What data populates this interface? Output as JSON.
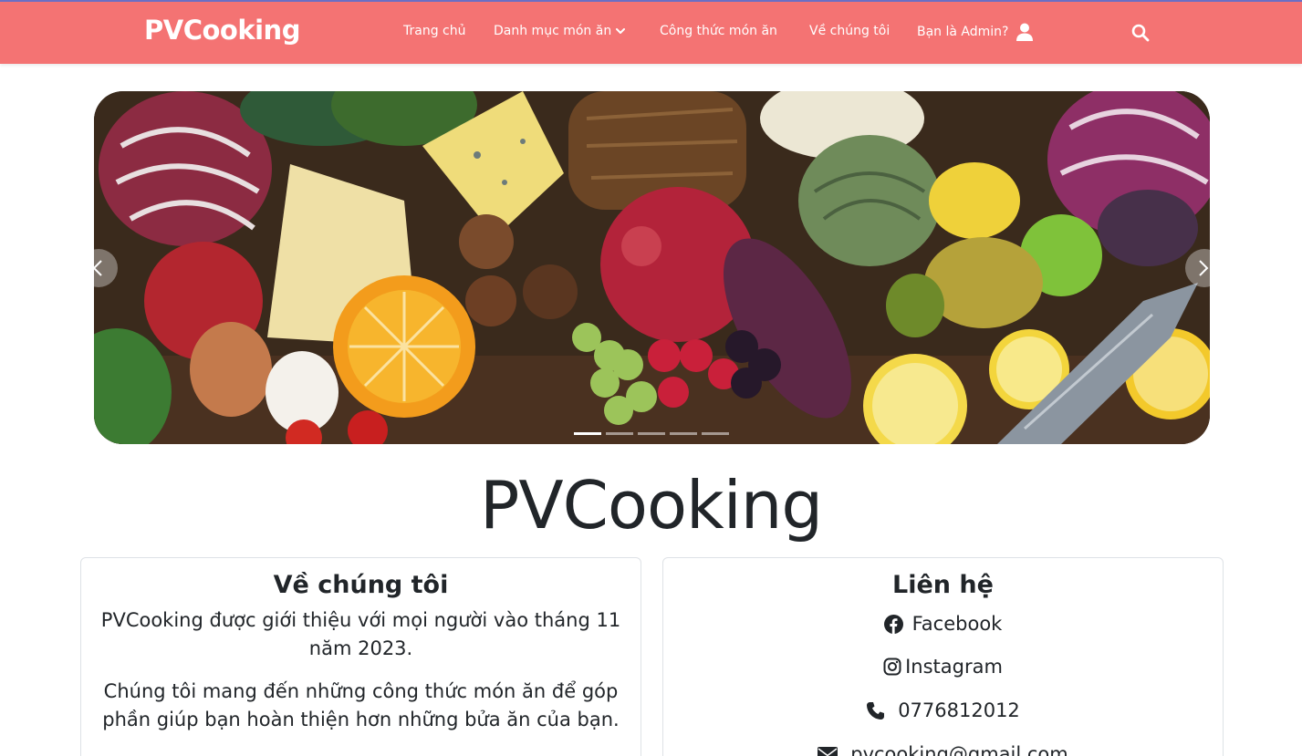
{
  "header": {
    "brand": "PVCooking",
    "nav": {
      "home": "Trang chủ",
      "categories": "Danh mục món ăn",
      "recipes": "Công thức món ăn",
      "about": "Về chúng tôi",
      "admin": "Bạn là Admin?"
    },
    "icons": {
      "dropdown": "chevron-down-icon",
      "user": "user-icon",
      "search": "search-icon"
    }
  },
  "carousel": {
    "slide_count": 5,
    "active_index": 0,
    "icons": {
      "prev": "chevron-left-icon",
      "next": "chevron-right-icon"
    }
  },
  "hero": {
    "title": "PVCooking"
  },
  "about": {
    "heading": "Về chúng tôi",
    "paragraph1": "PVCooking được giới thiệu với mọi người vào tháng 11 năm 2023.",
    "paragraph2": "Chúng tôi mang đến những công thức món ăn để góp phần giúp bạn hoàn thiện hơn những bửa ăn của bạn."
  },
  "contact": {
    "heading": "Liên hệ",
    "facebook": "Facebook",
    "instagram": "Instagram",
    "phone": "0776812012",
    "email": "pvcooking@gmail.com",
    "icons": {
      "facebook": "facebook-icon",
      "instagram": "instagram-icon",
      "phone": "phone-icon",
      "email": "envelope-icon"
    }
  },
  "colors": {
    "navbar": "#f47373",
    "navbar_border": "#6b6fc5",
    "text": "#212529",
    "card_border": "#dee2e6"
  }
}
